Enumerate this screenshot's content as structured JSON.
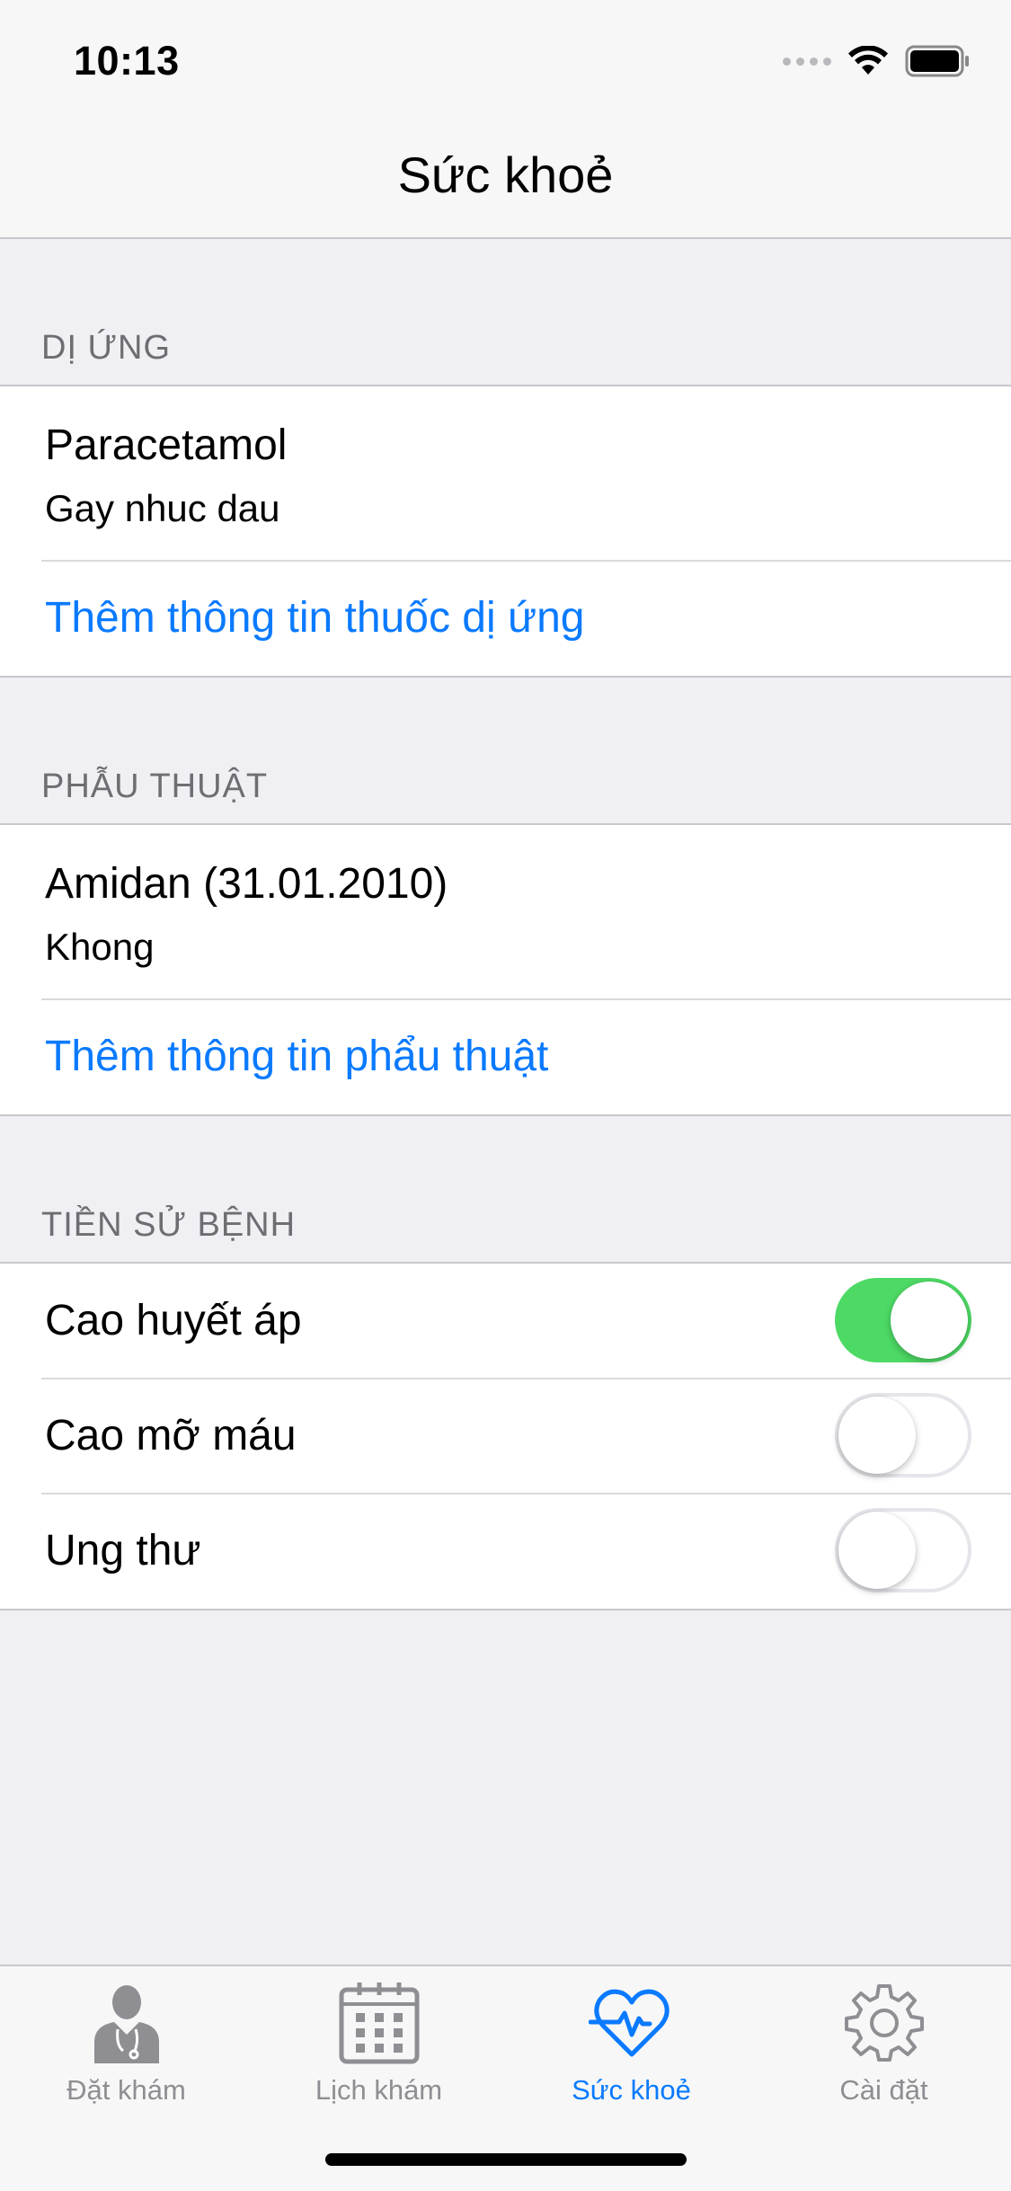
{
  "status_bar": {
    "time": "10:13"
  },
  "nav": {
    "title": "Sức khoẻ"
  },
  "sections": {
    "allergy": {
      "header": "DỊ ỨNG",
      "item_title": "Paracetamol",
      "item_subtitle": "Gay nhuc dau",
      "add_link": "Thêm thông tin thuốc dị ứng"
    },
    "surgery": {
      "header": "PHẪU THUẬT",
      "item_title": "Amidan (31.01.2010)",
      "item_subtitle": "Khong",
      "add_link": "Thêm thông tin phẩu thuật"
    },
    "history": {
      "header": "TIỀN SỬ BỆNH",
      "items": [
        {
          "label": "Cao huyết áp",
          "enabled": true
        },
        {
          "label": "Cao mỡ máu",
          "enabled": false
        },
        {
          "label": "Ung thư",
          "enabled": false
        }
      ]
    }
  },
  "tab_bar": {
    "tabs": [
      {
        "label": "Đặt khám",
        "icon": "doctor-icon",
        "active": false
      },
      {
        "label": "Lịch khám",
        "icon": "calendar-icon",
        "active": false
      },
      {
        "label": "Sức khoẻ",
        "icon": "heart-pulse-icon",
        "active": true
      },
      {
        "label": "Cài đặt",
        "icon": "gear-icon",
        "active": false
      }
    ]
  },
  "colors": {
    "accent": "#0a7aff",
    "toggle_on": "#4cd964",
    "inactive_tab": "#8e8e93",
    "background": "#efeff4"
  }
}
